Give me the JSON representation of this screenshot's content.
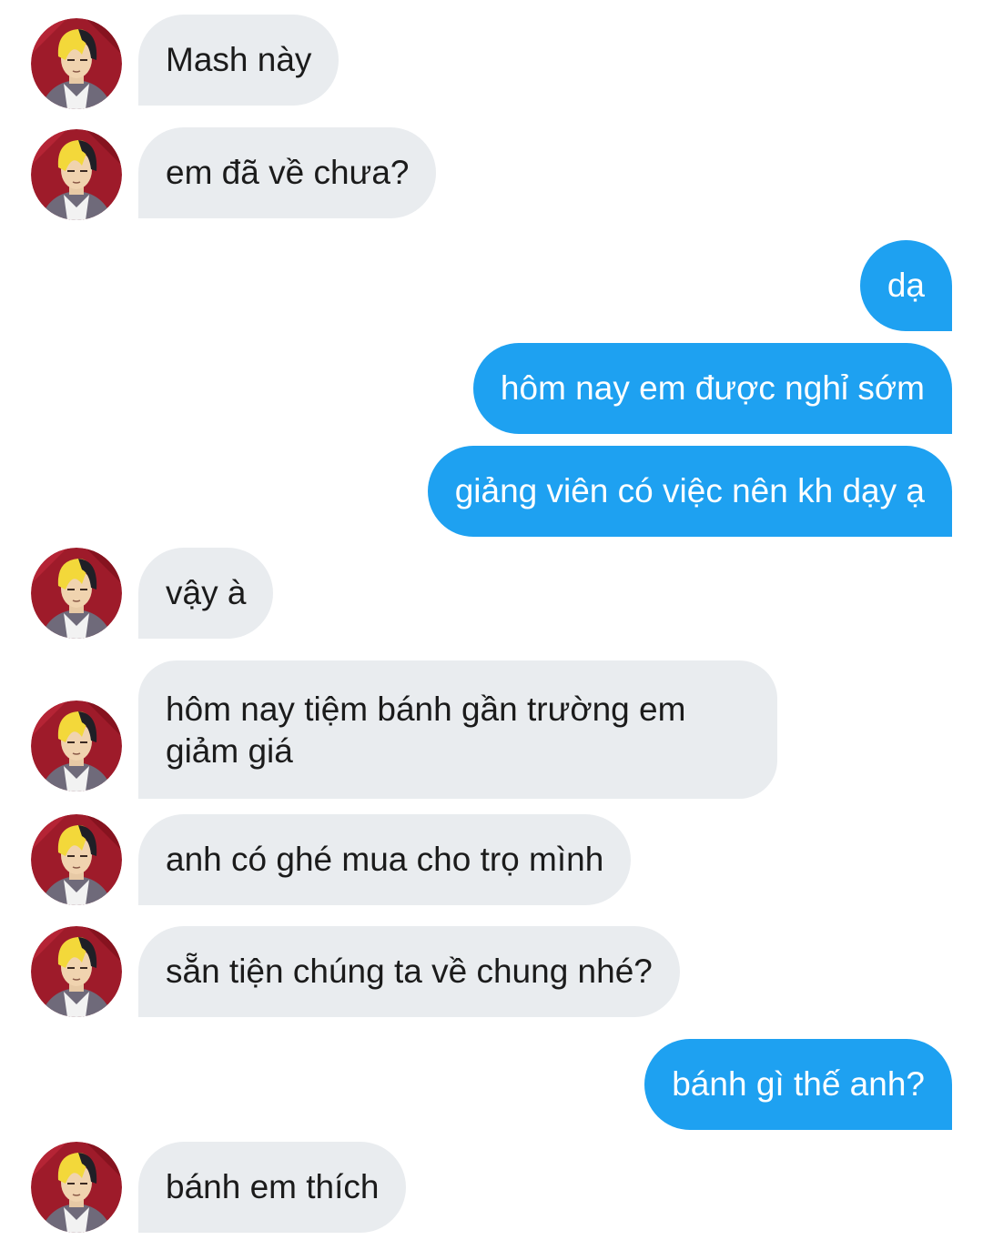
{
  "conversation": {
    "messages": [
      {
        "id": "m1",
        "side": "in",
        "text": "Mash này"
      },
      {
        "id": "m2",
        "side": "in",
        "text": "em đã về chưa?"
      },
      {
        "id": "m3",
        "side": "out",
        "text": "dạ"
      },
      {
        "id": "m4",
        "side": "out",
        "text": "hôm nay em được nghỉ sớm"
      },
      {
        "id": "m5",
        "side": "out",
        "text": "giảng viên có việc nên kh dạy ạ"
      },
      {
        "id": "m6",
        "side": "in",
        "text": "vậy à"
      },
      {
        "id": "m7",
        "side": "in",
        "text": "hôm nay tiệm bánh gần trường em giảm giá"
      },
      {
        "id": "m8",
        "side": "in",
        "text": "anh có ghé mua cho trọ mình"
      },
      {
        "id": "m9",
        "side": "in",
        "text": "sẵn tiện chúng ta về chung nhé?"
      },
      {
        "id": "m10",
        "side": "out",
        "text": "bánh gì thế anh?"
      },
      {
        "id": "m11",
        "side": "in",
        "text": "bánh em thích"
      }
    ]
  },
  "colors": {
    "incoming_bubble": "#e9ecef",
    "outgoing_bubble": "#1ea1f1",
    "incoming_text": "#1b1b1b",
    "outgoing_text": "#ffffff"
  },
  "icons": {
    "contact_avatar": "anime-character-avatar-icon"
  }
}
